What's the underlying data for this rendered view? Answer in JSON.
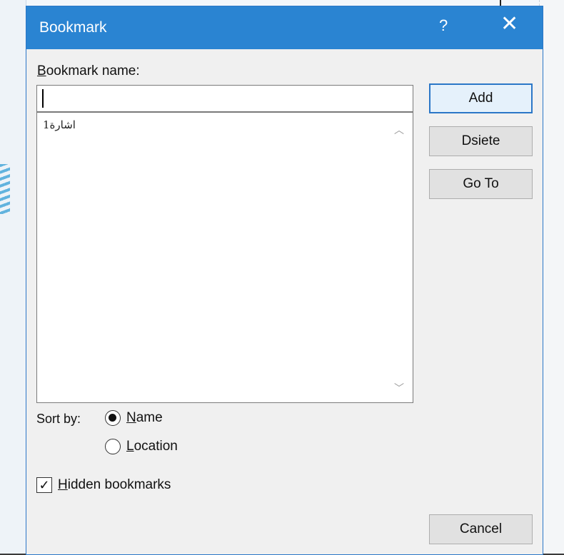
{
  "dialog": {
    "title": "Bookmark",
    "help_symbol": "?",
    "close_symbol": "✕"
  },
  "name_field": {
    "label": "Bookmark name:",
    "label_accel": "B",
    "label_rest": "ookmark name:",
    "value": ""
  },
  "bookmarks": [
    "اشارة1"
  ],
  "buttons": {
    "add": "Add",
    "delete": "Dsiete",
    "goto": "Go To",
    "cancel": "Cancel"
  },
  "sort": {
    "label": "Sort by:",
    "options": [
      {
        "accel": "N",
        "rest": "ame",
        "checked": true
      },
      {
        "accel": "L",
        "rest": "ocation",
        "checked": false
      }
    ]
  },
  "hidden_bookmarks": {
    "accel": "H",
    "rest": "idden bookmarks",
    "checked": true,
    "check_glyph": "✓"
  },
  "icons": {
    "scroll_up": "︿",
    "scroll_down": "﹀"
  }
}
